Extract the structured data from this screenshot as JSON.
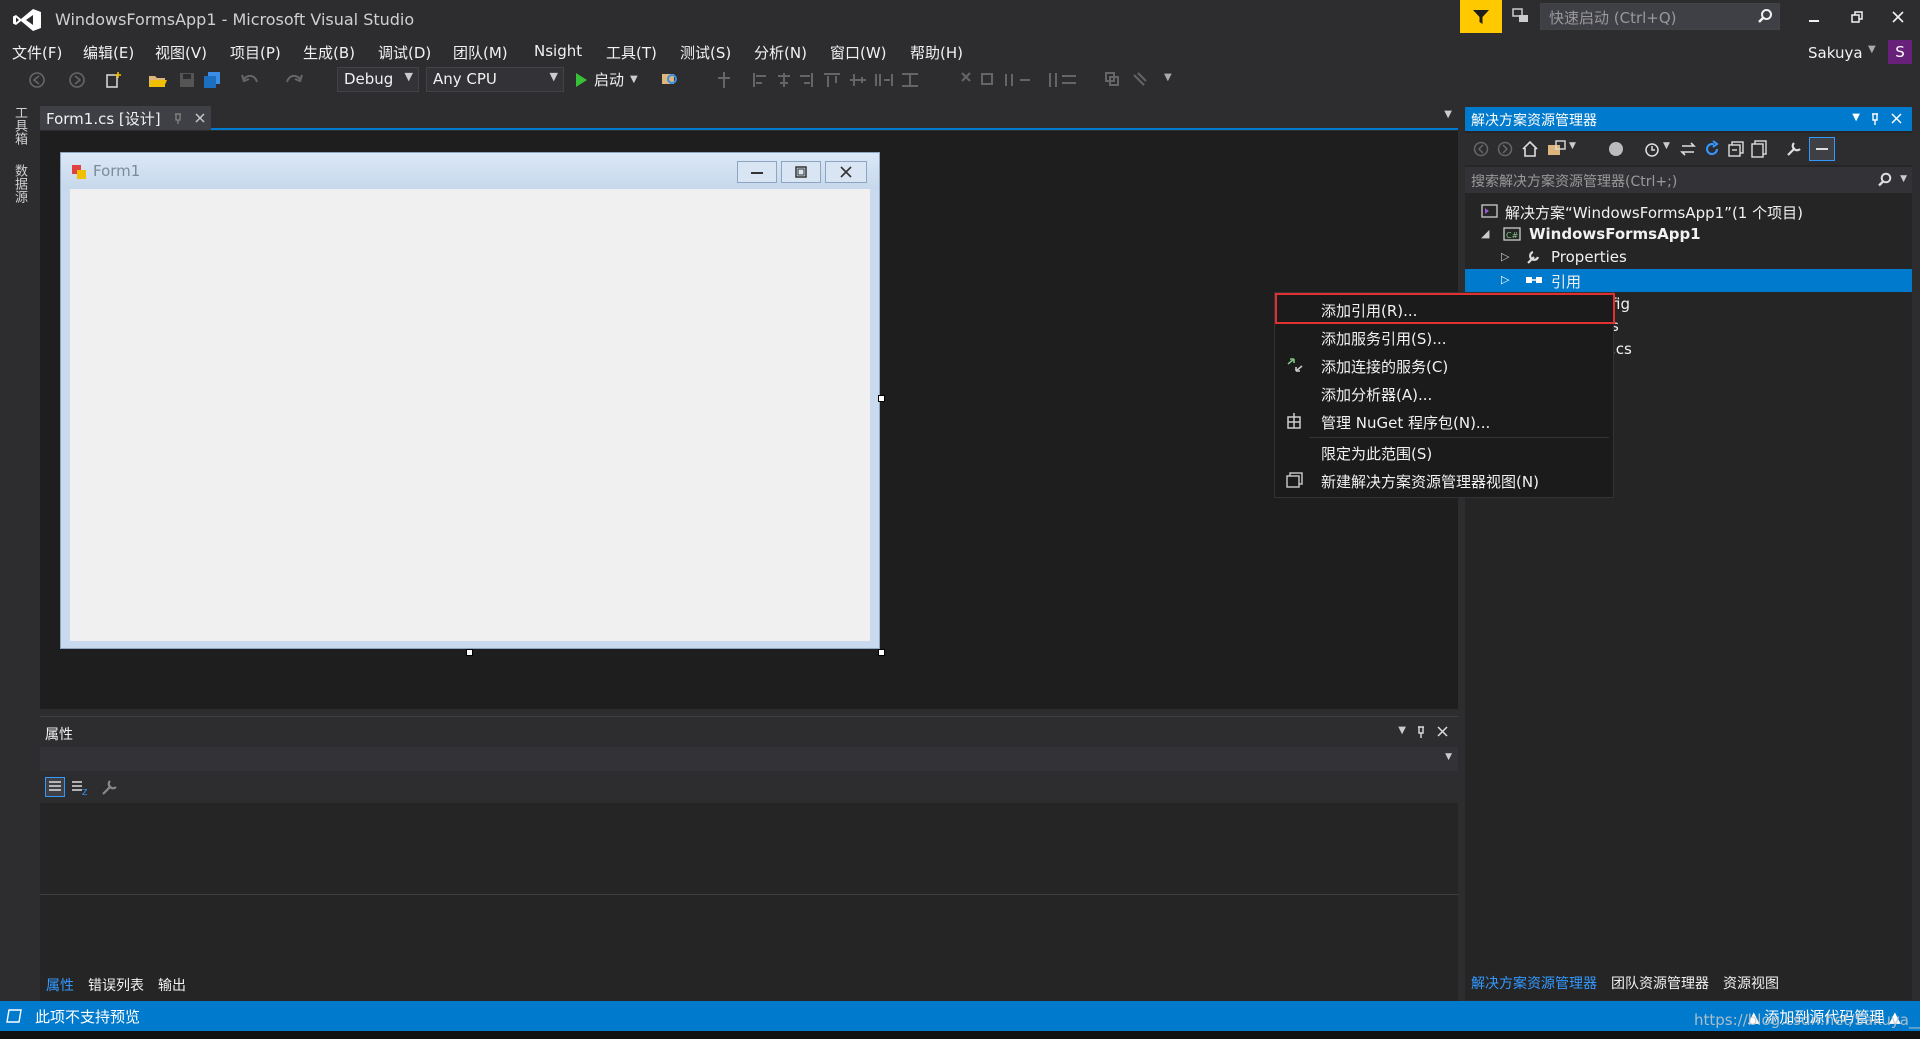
{
  "window": {
    "title": "WindowsFormsApp1 - Microsoft Visual Studio",
    "quick_launch_placeholder": "快速启动 (Ctrl+Q)"
  },
  "menu": {
    "items": [
      "文件(F)",
      "编辑(E)",
      "视图(V)",
      "项目(P)",
      "生成(B)",
      "调试(D)",
      "团队(M)",
      "Nsight",
      "工具(T)",
      "测试(S)",
      "分析(N)",
      "窗口(W)",
      "帮助(H)"
    ]
  },
  "user": {
    "name": "Sakuya",
    "initial": "S"
  },
  "toolbar": {
    "configuration": "Debug",
    "platform": "Any CPU",
    "start_label": "启动"
  },
  "left_tabs": [
    "工具箱",
    "数据源"
  ],
  "document": {
    "tab_label": "Form1.cs [设计]",
    "form_title": "Form1"
  },
  "properties": {
    "title": "属性",
    "bottom_tabs": [
      "属性",
      "错误列表",
      "输出"
    ]
  },
  "solution_explorer": {
    "title": "解决方案资源管理器",
    "search_placeholder": "搜索解决方案资源管理器(Ctrl+;)",
    "tree": {
      "solution": "解决方案“WindowsFormsApp1”(1 个项目)",
      "project": "WindowsFormsApp1",
      "properties": "Properties",
      "references": "引用",
      "partial_1": "fig",
      "partial_2": "s",
      "partial_3": ".cs"
    },
    "bottom_tabs": [
      "解决方案资源管理器",
      "团队资源管理器",
      "资源视图"
    ]
  },
  "context_menu": {
    "items": [
      "添加引用(R)...",
      "添加服务引用(S)...",
      "添加连接的服务(C)",
      "添加分析器(A)...",
      "管理 NuGet 程序包(N)...",
      "限定为此范围(S)",
      "新建解决方案资源管理器视图(N)"
    ]
  },
  "status": {
    "left": "此项不支持预览",
    "right": "添加到源代码管理",
    "watermark": "https://blog.csdn.net/Sakuya__"
  },
  "colors": {
    "accent": "#007acc",
    "background": "#2d2d30",
    "highlight_box": "#e03030",
    "filter_button": "#ffc900"
  }
}
